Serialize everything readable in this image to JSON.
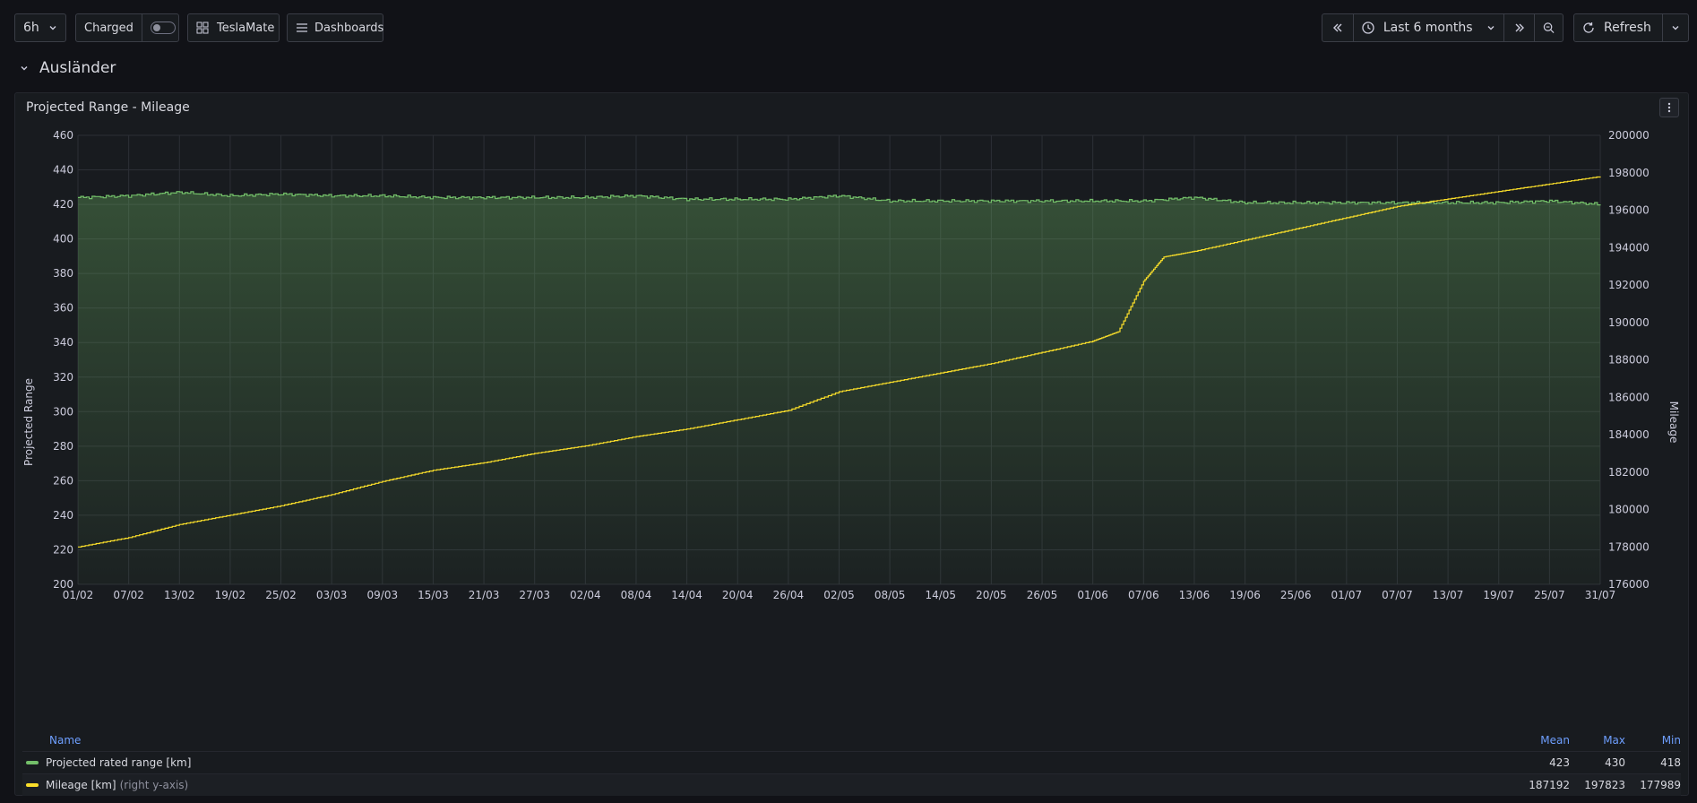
{
  "toolbar": {
    "interval": "6h",
    "toggle_label": "Charged",
    "toggle_on": false,
    "home_link": "TeslaMate",
    "dashboards_link": "Dashboards",
    "time_range": "Last 6 months",
    "refresh_label": "Refresh"
  },
  "row_title": "Ausländer",
  "panel": {
    "title": "Projected Range - Mileage"
  },
  "chart_data": {
    "type": "line",
    "x_ticks": [
      "01/02",
      "07/02",
      "13/02",
      "19/02",
      "25/02",
      "03/03",
      "09/03",
      "15/03",
      "21/03",
      "27/03",
      "02/04",
      "08/04",
      "14/04",
      "20/04",
      "26/04",
      "02/05",
      "08/05",
      "14/05",
      "20/05",
      "26/05",
      "01/06",
      "07/06",
      "13/06",
      "19/06",
      "25/06",
      "01/07",
      "07/07",
      "13/07",
      "19/07",
      "25/07",
      "31/07"
    ],
    "y_left": {
      "label": "Projected Range",
      "min": 200,
      "max": 460,
      "ticks": [
        460,
        440,
        420,
        400,
        380,
        360,
        340,
        320,
        300,
        280,
        260,
        240,
        220,
        200
      ]
    },
    "y_right": {
      "label": "Mileage",
      "min": 176000,
      "max": 200000,
      "ticks": [
        200000,
        198000,
        196000,
        194000,
        192000,
        190000,
        188000,
        186000,
        184000,
        182000,
        180000,
        178000,
        176000
      ]
    },
    "series": [
      {
        "name": "Projected rated range [km]",
        "axis": "left",
        "color": "#73bf69",
        "mean": "423",
        "max": "430",
        "min": "418",
        "points": [
          [
            0,
            424
          ],
          [
            1,
            425
          ],
          [
            2,
            427
          ],
          [
            3,
            425
          ],
          [
            4,
            426
          ],
          [
            5,
            425
          ],
          [
            6,
            425
          ],
          [
            7,
            424
          ],
          [
            8,
            424
          ],
          [
            9,
            424
          ],
          [
            10,
            424
          ],
          [
            11,
            425
          ],
          [
            12,
            423
          ],
          [
            13,
            423
          ],
          [
            14,
            423
          ],
          [
            15,
            425
          ],
          [
            16,
            422
          ],
          [
            17,
            422
          ],
          [
            18,
            422
          ],
          [
            19,
            422
          ],
          [
            20,
            422
          ],
          [
            21,
            422
          ],
          [
            22,
            424
          ],
          [
            23,
            421
          ],
          [
            24,
            421
          ],
          [
            25,
            421
          ],
          [
            26,
            421
          ],
          [
            27,
            421
          ],
          [
            28,
            421
          ],
          [
            29,
            422
          ],
          [
            30,
            420
          ]
        ]
      },
      {
        "name": "Mileage [km]",
        "suffix": "(right y-axis)",
        "axis": "right",
        "color": "#fade2a",
        "mean": "187192",
        "max": "197823",
        "min": "177989",
        "points": [
          [
            0,
            178000
          ],
          [
            1,
            178500
          ],
          [
            2,
            179200
          ],
          [
            3,
            179700
          ],
          [
            4,
            180200
          ],
          [
            5,
            180800
          ],
          [
            6,
            181500
          ],
          [
            7,
            182100
          ],
          [
            8,
            182500
          ],
          [
            9,
            183000
          ],
          [
            10,
            183400
          ],
          [
            11,
            183900
          ],
          [
            12,
            184300
          ],
          [
            13,
            184800
          ],
          [
            14,
            185300
          ],
          [
            15,
            186300
          ],
          [
            16,
            186800
          ],
          [
            17,
            187300
          ],
          [
            18,
            187800
          ],
          [
            19,
            188400
          ],
          [
            20,
            189000
          ],
          [
            20.5,
            189500
          ],
          [
            21,
            192200
          ],
          [
            21.4,
            193500
          ],
          [
            22,
            193800
          ],
          [
            23,
            194400
          ],
          [
            24,
            195000
          ],
          [
            25,
            195600
          ],
          [
            26,
            196200
          ],
          [
            27,
            196600
          ],
          [
            28,
            197000
          ],
          [
            29,
            197400
          ],
          [
            30,
            197800
          ]
        ]
      }
    ]
  },
  "legend": {
    "col_name": "Name",
    "col_mean": "Mean",
    "col_max": "Max",
    "col_min": "Min"
  }
}
